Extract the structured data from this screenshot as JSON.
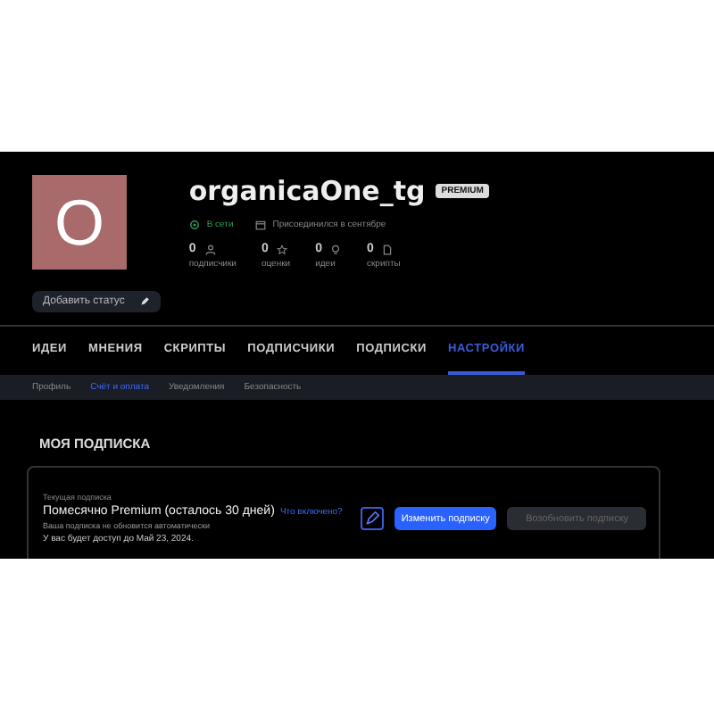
{
  "profile": {
    "avatar_letter": "O",
    "username": "organicaOne_tg",
    "badge": "PREMIUM",
    "online": "В сети",
    "joined": "Присоединился в сентябре",
    "stats": [
      {
        "value": "0",
        "label": "подписчики"
      },
      {
        "value": "0",
        "label": "оценки"
      },
      {
        "value": "0",
        "label": "идеи"
      },
      {
        "value": "0",
        "label": "скрипты"
      }
    ],
    "status_button": "Добавить статус"
  },
  "tabs": [
    {
      "label": "ИДЕИ",
      "selected": false
    },
    {
      "label": "МНЕНИЯ",
      "selected": false
    },
    {
      "label": "СКРИПТЫ",
      "selected": false
    },
    {
      "label": "ПОДПИСЧИКИ",
      "selected": false
    },
    {
      "label": "ПОДПИСКИ",
      "selected": false
    },
    {
      "label": "НАСТРОЙКИ",
      "selected": true
    }
  ],
  "subtabs": [
    {
      "label": "Профиль",
      "selected": false
    },
    {
      "label": "Счёт и оплата",
      "selected": true
    },
    {
      "label": "Уведомления",
      "selected": false
    },
    {
      "label": "Безопасность",
      "selected": false
    }
  ],
  "section_title": "МОЯ ПОДПИСКА",
  "subscription": {
    "caption": "Текущая подписка",
    "plan": "Помесячно Premium (осталось 30 дней)",
    "link": "Что включено?",
    "note": "Ваша подписка не обновится автоматически",
    "access": "У вас будет доступ до Май 23, 2024.",
    "buttons": [
      {
        "label": "Изменить подписку",
        "disabled": false
      },
      {
        "label": "Возобновить подписку",
        "disabled": true
      }
    ]
  }
}
